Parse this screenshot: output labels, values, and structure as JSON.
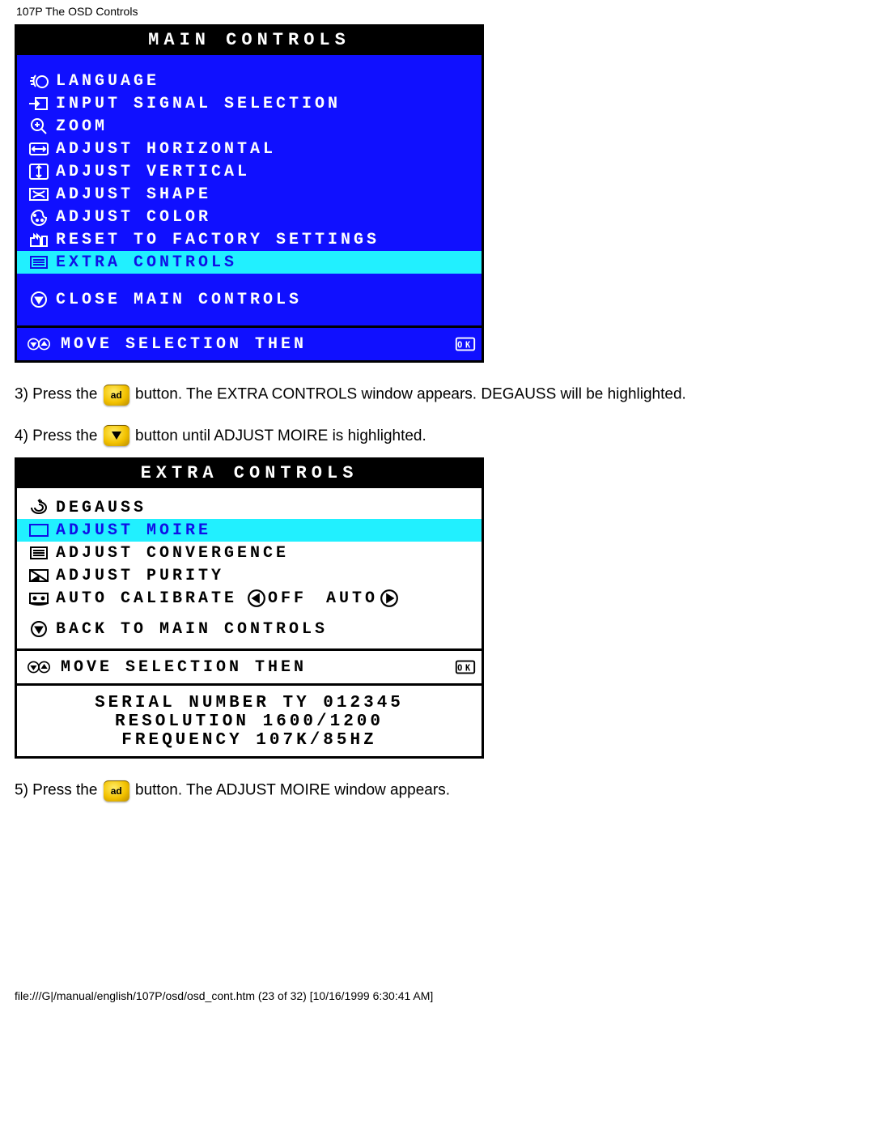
{
  "header": "107P The OSD Controls",
  "main_controls": {
    "title": "MAIN CONTROLS",
    "items": [
      {
        "id": "language",
        "label": "LANGUAGE"
      },
      {
        "id": "input",
        "label": "INPUT SIGNAL SELECTION"
      },
      {
        "id": "zoom",
        "label": "ZOOM"
      },
      {
        "id": "adjh",
        "label": "ADJUST HORIZONTAL"
      },
      {
        "id": "adjv",
        "label": "ADJUST VERTICAL"
      },
      {
        "id": "shape",
        "label": "ADJUST SHAPE"
      },
      {
        "id": "color",
        "label": "ADJUST COLOR"
      },
      {
        "id": "reset",
        "label": "RESET TO FACTORY SETTINGS"
      },
      {
        "id": "extra",
        "label": "EXTRA CONTROLS",
        "highlight": true
      }
    ],
    "close": "CLOSE MAIN CONTROLS",
    "footer": "MOVE SELECTION THEN"
  },
  "step3": {
    "prefix": "3) Press the",
    "suffix": "button. The EXTRA CONTROLS window appears. DEGAUSS will be highlighted."
  },
  "step4": {
    "prefix": "4) Press the",
    "suffix": "button until ADJUST MOIRE is highlighted."
  },
  "extra_controls": {
    "title": "EXTRA CONTROLS",
    "items": [
      {
        "id": "degauss",
        "label": "DEGAUSS"
      },
      {
        "id": "moire",
        "label": "ADJUST MOIRE",
        "highlight": true
      },
      {
        "id": "converge",
        "label": "ADJUST CONVERGENCE"
      },
      {
        "id": "purity",
        "label": "ADJUST PURITY"
      }
    ],
    "calibrate": {
      "label": "AUTO CALIBRATE",
      "left": "OFF",
      "right": "AUTO"
    },
    "back": "BACK TO MAIN CONTROLS",
    "footer": "MOVE SELECTION THEN",
    "info": {
      "serial": "SERIAL NUMBER TY 012345",
      "resolution": "RESOLUTION 1600/1200",
      "frequency": "FREQUENCY 107K/85HZ"
    }
  },
  "step5": {
    "prefix": "5) Press the",
    "suffix": "button. The ADJUST MOIRE window appears."
  },
  "footer": "file:///G|/manual/english/107P/osd/osd_cont.htm (23 of 32) [10/16/1999 6:30:41 AM]"
}
